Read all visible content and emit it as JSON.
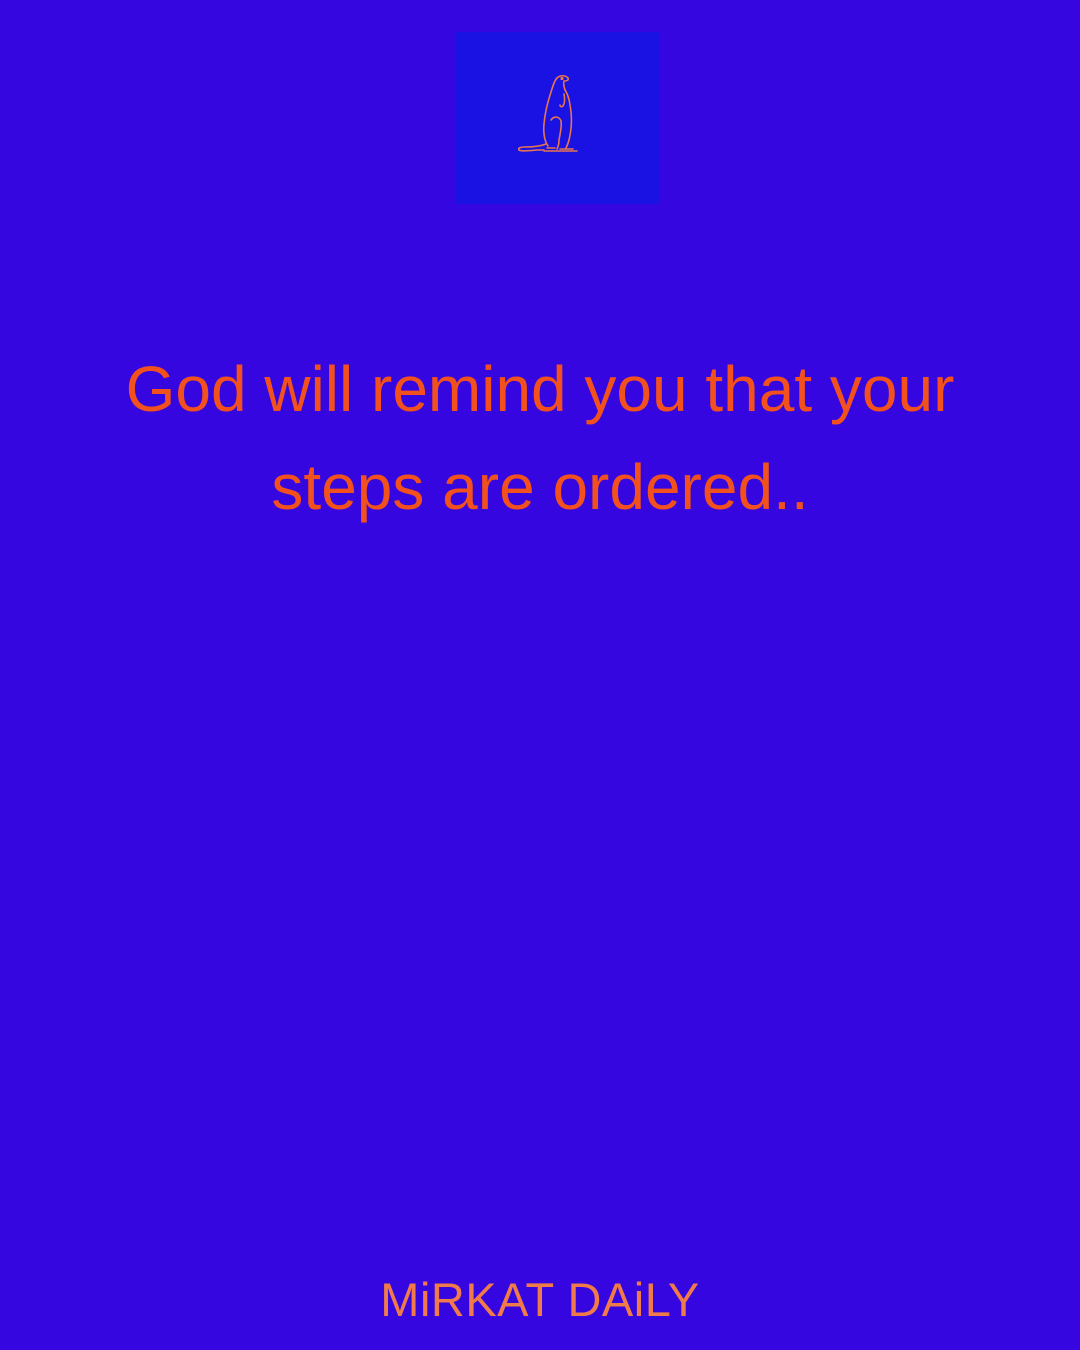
{
  "background_color": "#3506df",
  "logo": {
    "icon": "meerkat-icon",
    "box_color": "#1a12e2",
    "stroke_color": "#e8744f"
  },
  "quote": {
    "text": "God will remind you that your steps are ordered..",
    "color": "#f2511e"
  },
  "brand": {
    "text": "MiRKAT DAiLY",
    "color": "#f07a4a"
  }
}
